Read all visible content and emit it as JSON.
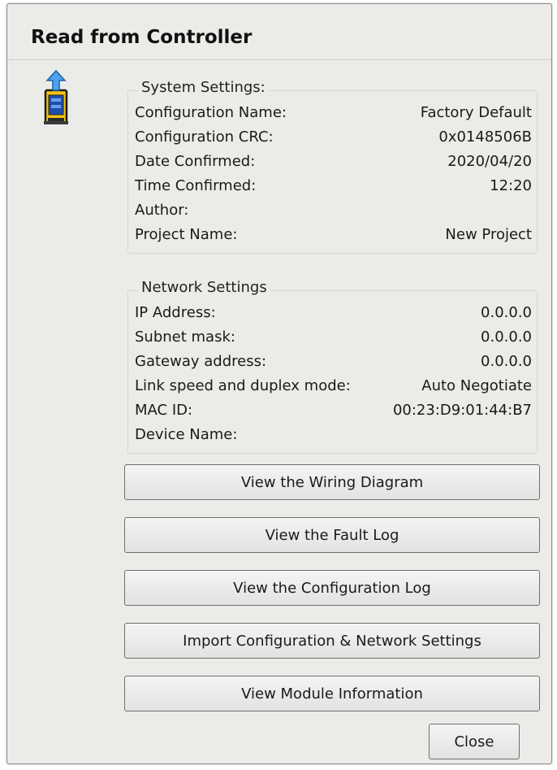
{
  "dialog": {
    "title": "Read from Controller",
    "icon": "controller-upload-icon"
  },
  "system": {
    "group_label": "System Settings:",
    "rows": [
      {
        "label": "Configuration Name:",
        "value": "Factory Default"
      },
      {
        "label": "Configuration CRC:",
        "value": "0x0148506B"
      },
      {
        "label": "Date Confirmed:",
        "value": "2020/04/20"
      },
      {
        "label": "Time Confirmed:",
        "value": "12:20"
      },
      {
        "label": "Author:",
        "value": ""
      },
      {
        "label": "Project Name:",
        "value": "New Project"
      }
    ]
  },
  "network": {
    "group_label": "Network Settings",
    "rows": [
      {
        "label": "IP Address:",
        "value": "0.0.0.0"
      },
      {
        "label": "Subnet mask:",
        "value": "0.0.0.0"
      },
      {
        "label": "Gateway address:",
        "value": "0.0.0.0"
      },
      {
        "label": "Link speed and duplex mode:",
        "value": "Auto Negotiate"
      },
      {
        "label": "MAC ID:",
        "value": "00:23:D9:01:44:B7"
      },
      {
        "label": "Device Name:",
        "value": ""
      }
    ]
  },
  "buttons": {
    "wiring": "View the Wiring Diagram",
    "fault": "View the Fault Log",
    "config_log": "View the Configuration Log",
    "import": "Import Configuration & Network Settings",
    "module": "View Module Information",
    "close": "Close"
  }
}
